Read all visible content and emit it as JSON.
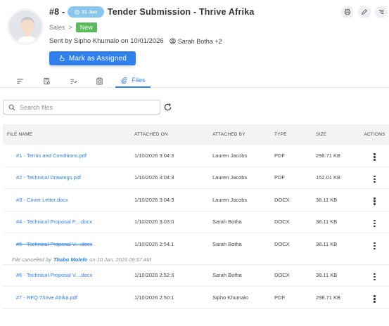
{
  "ticket": {
    "number": "#8 -",
    "date_pill": "31 Jan",
    "title": "Tender Submission - Thrive Afrika"
  },
  "breadcrumb": {
    "section": "Sales",
    "separator": ">",
    "status": "New"
  },
  "sent": {
    "text": "Sent by Sipho Khumalo on 10/01/2026",
    "people": "Sarah Botha +2"
  },
  "assign_button": "Mark as Assigned",
  "tabs": {
    "files_label": "Files"
  },
  "search": {
    "placeholder": "Search files"
  },
  "table": {
    "headers": {
      "name": "FILE NAME",
      "attached_on": "ATTACHED ON",
      "attached_by": "ATTACHED BY",
      "type": "TYPE",
      "size": "SIZE",
      "actions": "ACTIONS"
    },
    "rows": [
      {
        "name": "#1 - Terms and Conditions.pdf",
        "attached_on": "1/10/2026 3:04:3",
        "attached_by": "Lauren Jacobs",
        "type": "PDF",
        "size": "298.71 KB"
      },
      {
        "name": "#2 - Technical Drawings.pdf",
        "attached_on": "1/10/2026 3:04:3",
        "attached_by": "Lauren Jacobs",
        "type": "PDF",
        "size": "152.01 KB"
      },
      {
        "name": "#3 - Cover Letter.docx",
        "attached_on": "1/10/2026 3:04:3",
        "attached_by": "Lauren Jacobs",
        "type": "DOCX",
        "size": "38.11 KB"
      },
      {
        "name": "#4 - Technical Proposal F....docx",
        "attached_on": "1/10/2026 3:03:0",
        "attached_by": "Sarah Botha",
        "type": "DOCX",
        "size": "38.11 KB"
      },
      {
        "name": "#5 - Technical Proposal V....docx",
        "attached_on": "1/10/2026 2:54:1",
        "attached_by": "Sarah Botha",
        "type": "DOCX",
        "size": "38.11 KB"
      },
      {
        "name": "#6 - Technical Proposal V....docx",
        "attached_on": "1/10/2026 2:52:3",
        "attached_by": "Sarah Botha",
        "type": "DOCX",
        "size": "38.11 KB"
      },
      {
        "name": "#7 - RFQ Thrive Afrika.pdf",
        "attached_on": "1/10/2026 2:50:1",
        "attached_by": "Sipho Khumalo",
        "type": "PDF",
        "size": "298.71 KB"
      }
    ],
    "cancel_note": {
      "prefix": "File cancelled by",
      "user": "Thabo Molefe",
      "suffix": "on 10 Jan, 2026 09:57 AM"
    }
  },
  "colors": {
    "accent": "#2f80ed",
    "new_badge": "#5cb85c",
    "date_pill": "#89c7ee"
  }
}
